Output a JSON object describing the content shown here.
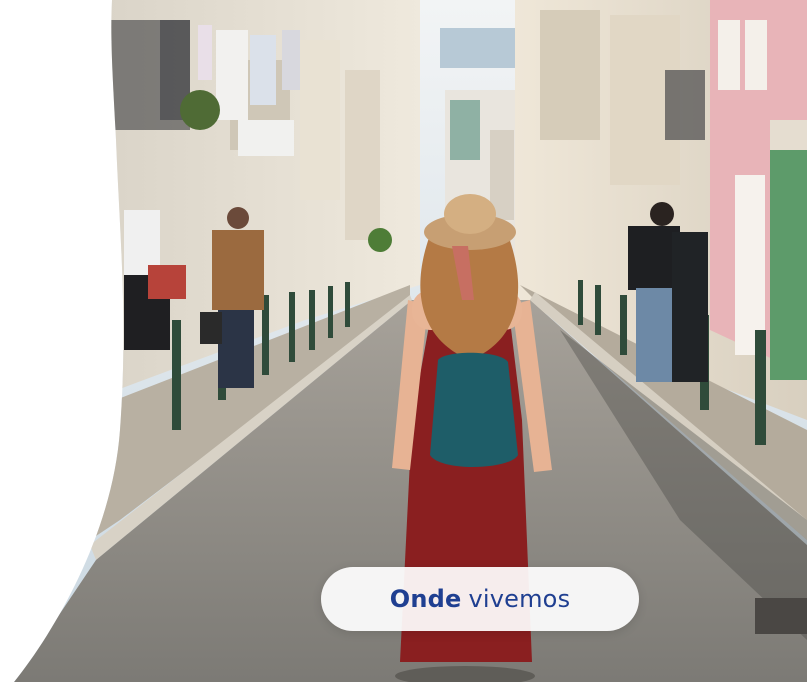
{
  "hero": {
    "image_alt": "",
    "colors": {
      "sky": "#dbe5ec",
      "street": "#8c8a85",
      "sidewalk": "#b9b1a3",
      "dress": "#8b1e1f",
      "backpack": "#1e5d68",
      "hat": "#cfa77a",
      "hair": "#b47a45",
      "pink_building": "#e7b3b7",
      "green_accent": "#5b9b6a"
    }
  },
  "cta": {
    "bold_text": "Onde",
    "regular_text": "vivemos",
    "text_color": "#1f3f91"
  }
}
